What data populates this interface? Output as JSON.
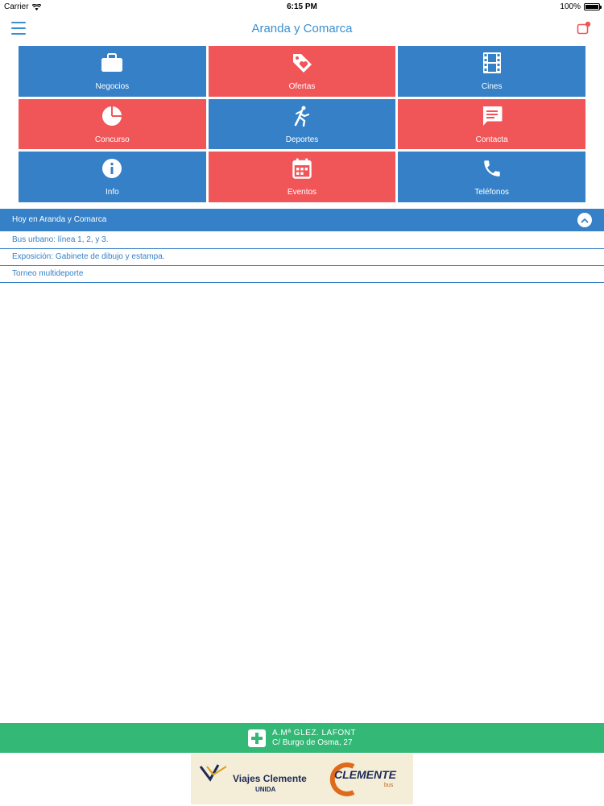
{
  "status_bar": {
    "carrier": "Carrier",
    "time": "6:15 PM",
    "battery": "100%",
    "battery_level": 1.0
  },
  "nav": {
    "title": "Aranda y Comarca"
  },
  "tiles": [
    {
      "label": "Negocios",
      "icon": "briefcase-icon",
      "color": "#3580c7"
    },
    {
      "label": "Ofertas",
      "icon": "tag-heart-icon",
      "color": "#f05558"
    },
    {
      "label": "Cines",
      "icon": "film-icon",
      "color": "#3580c7"
    },
    {
      "label": "Concurso",
      "icon": "pie-chart-icon",
      "color": "#f05558"
    },
    {
      "label": "Deportes",
      "icon": "runner-icon",
      "color": "#3580c7"
    },
    {
      "label": "Contacta",
      "icon": "chat-icon",
      "color": "#f05558"
    },
    {
      "label": "Info",
      "icon": "info-icon",
      "color": "#3580c7"
    },
    {
      "label": "Eventos",
      "icon": "calendar-icon",
      "color": "#f05558"
    },
    {
      "label": "Teléfonos",
      "icon": "phone-icon",
      "color": "#3580c7"
    }
  ],
  "today": {
    "title": "Hoy en Aranda y Comarca",
    "items": [
      "Bus urbano: línea 1, 2, y 3.",
      "Exposición: Gabinete de dibujo y estampa.",
      "Torneo multideporte"
    ]
  },
  "pharmacy": {
    "name": "A.Mª GLEZ. LAFONT",
    "address": "C/ Burgo de Osma, 27",
    "color": "#33b876"
  },
  "ad": {
    "brand_left": "Viajes Clemente",
    "brand_left_sub": "UNIDA",
    "brand_right": "CLEMENTE",
    "brand_right_sub": "bus"
  }
}
